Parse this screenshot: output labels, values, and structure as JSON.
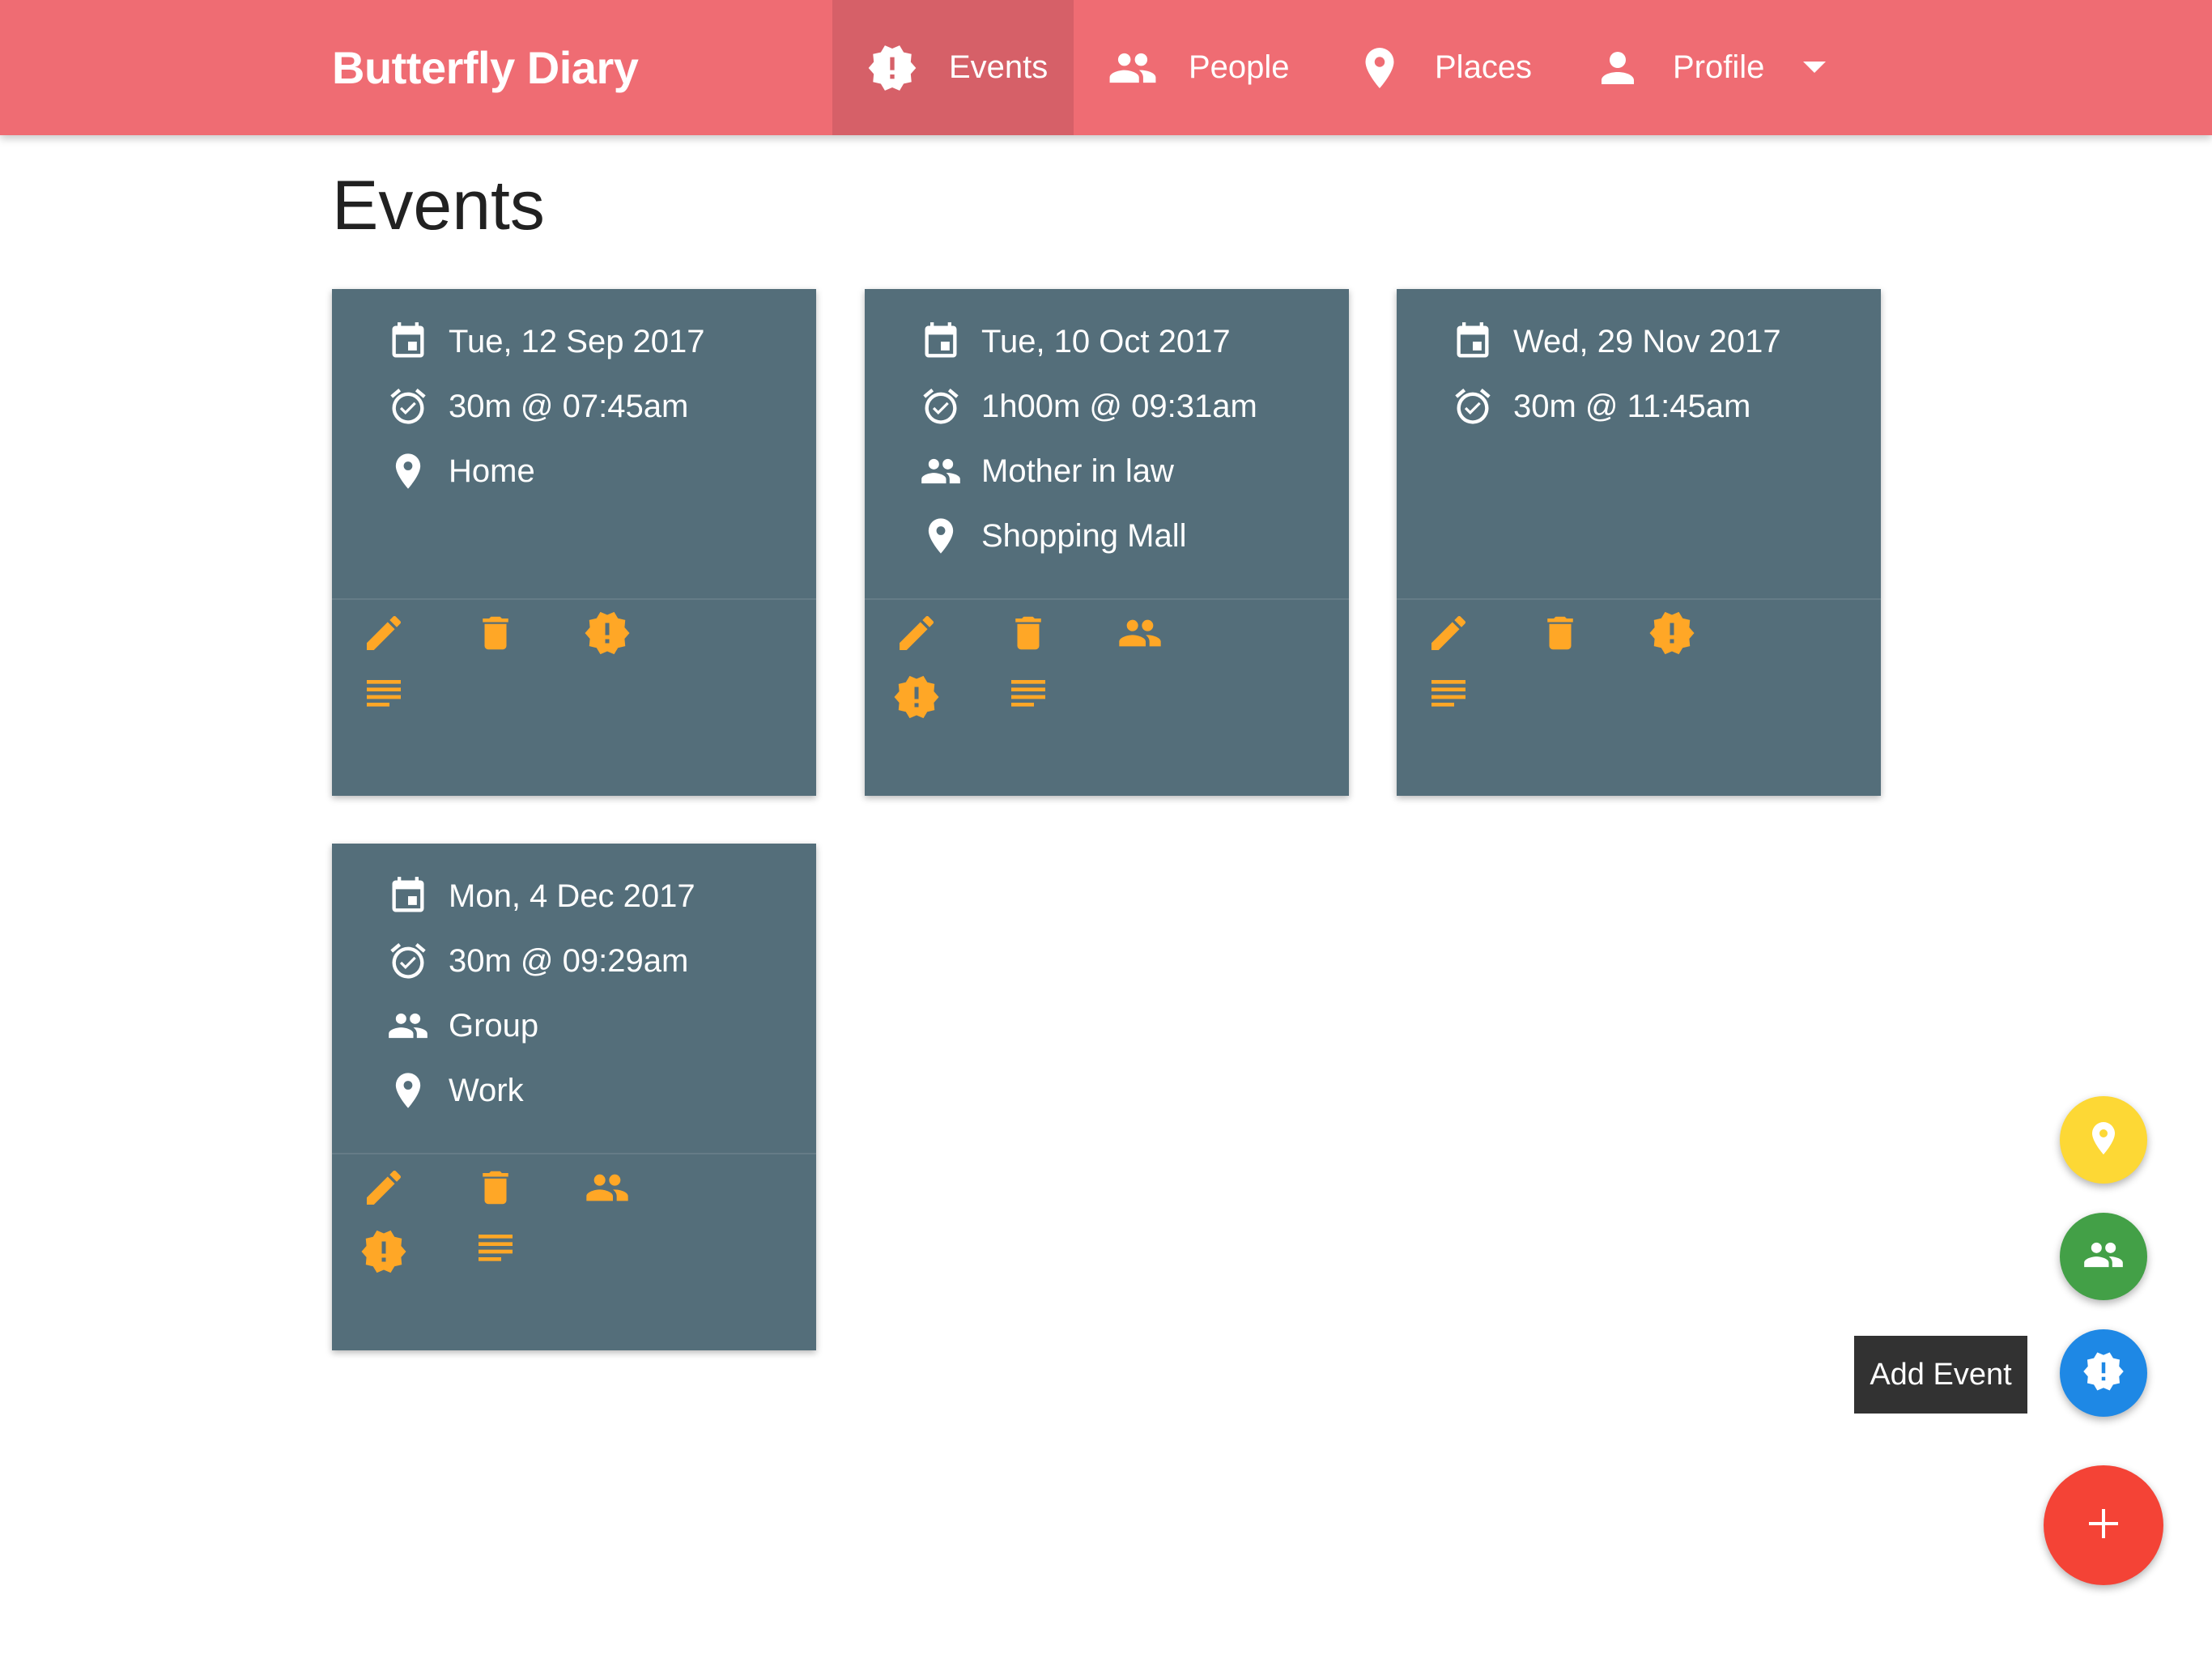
{
  "app": {
    "title": "Butterfly Diary"
  },
  "nav": {
    "items": [
      {
        "label": "Events",
        "icon": "event-alert-icon",
        "active": true
      },
      {
        "label": "People",
        "icon": "people-icon",
        "active": false
      },
      {
        "label": "Places",
        "icon": "place-icon",
        "active": false
      },
      {
        "label": "Profile",
        "icon": "person-icon",
        "active": false,
        "dropdown": true
      }
    ]
  },
  "page": {
    "title": "Events"
  },
  "events": [
    {
      "date": "Tue, 12 Sep 2017",
      "time": "30m @ 07:45am",
      "person": null,
      "place": "Home",
      "actions": [
        "edit",
        "delete",
        "event",
        "notes"
      ]
    },
    {
      "date": "Tue, 10 Oct 2017",
      "time": "1h00m @ 09:31am",
      "person": "Mother in law",
      "place": "Shopping Mall",
      "actions": [
        "edit",
        "delete",
        "people",
        "event",
        "notes"
      ]
    },
    {
      "date": "Wed, 29 Nov 2017",
      "time": "30m @ 11:45am",
      "person": null,
      "place": null,
      "actions": [
        "edit",
        "delete",
        "event",
        "notes"
      ]
    },
    {
      "date": "Mon, 4 Dec 2017",
      "time": "30m @ 09:29am",
      "person": "Group",
      "place": "Work",
      "actions": [
        "edit",
        "delete",
        "people",
        "event",
        "notes"
      ]
    }
  ],
  "fab": {
    "tooltip": "Add Event",
    "add_symbol": "+",
    "colors": {
      "places": "#fdd835",
      "people": "#43a047",
      "events": "#1e88e5",
      "add": "#f44336"
    }
  },
  "colors": {
    "navbar": "#ef6c73",
    "navbar_active": "#d66068",
    "card": "#546e7a",
    "action": "#ffa726"
  }
}
